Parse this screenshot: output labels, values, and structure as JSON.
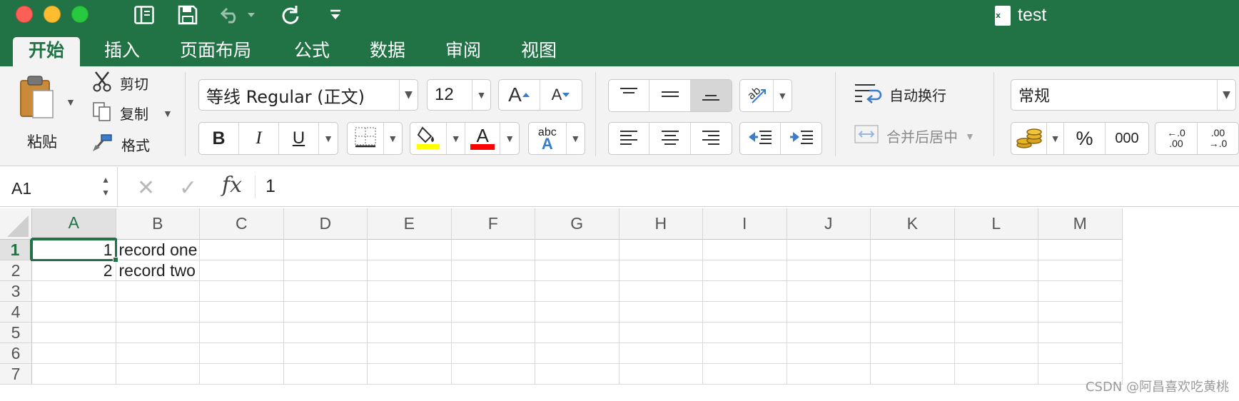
{
  "window": {
    "title": "test",
    "file_icon_letter": "x"
  },
  "tabs": [
    "开始",
    "插入",
    "页面布局",
    "公式",
    "数据",
    "审阅",
    "视图"
  ],
  "ribbon": {
    "paste": "粘贴",
    "cut": "剪切",
    "copy": "复制",
    "format_painter": "格式",
    "font_name": "等线 Regular (正文)",
    "font_size": "12",
    "bold": "B",
    "italic": "I",
    "underline": "U",
    "grow_font": "A",
    "shrink_font": "A",
    "font_color_letter": "A",
    "phonetic_small": "abc",
    "phonetic_big": "A",
    "wrap_text": "自动换行",
    "merge_center": "合并后居中",
    "number_format": "常规",
    "percent": "%",
    "thousands": "000",
    "inc_decimal_top": "←.0",
    "inc_decimal_bottom": ".00",
    "dec_decimal_top": ".00",
    "dec_decimal_bottom": "→.0"
  },
  "formula_bar": {
    "name_box": "A1",
    "fx": "fx",
    "value": "1"
  },
  "grid": {
    "columns": [
      "A",
      "B",
      "C",
      "D",
      "E",
      "F",
      "G",
      "H",
      "I",
      "J",
      "K",
      "L",
      "M"
    ],
    "rows": [
      "1",
      "2",
      "3",
      "4",
      "5",
      "6",
      "7"
    ],
    "selected_cell": "A1",
    "cells": {
      "A1": "1",
      "B1": "record one",
      "A2": "2",
      "B2": "record two"
    }
  },
  "colors": {
    "accent": "#217346",
    "highlight_yellow": "#ffff00",
    "font_red": "#ff0000"
  },
  "watermark": "CSDN @阿昌喜欢吃黄桃"
}
